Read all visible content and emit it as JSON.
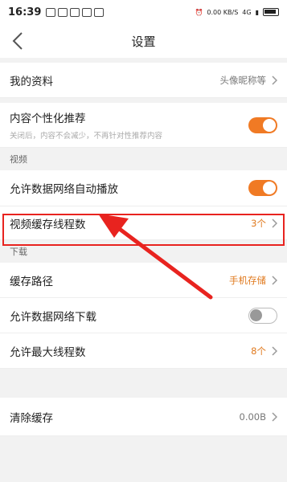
{
  "status_bar": {
    "time": "16:39",
    "net_speed": "0.00 KB/S",
    "network": "4G"
  },
  "header": {
    "title": "设置"
  },
  "rows": {
    "profile": {
      "label": "我的资料",
      "value": "头像昵称等"
    },
    "personalization": {
      "label": "内容个性化推荐",
      "sub": "关闭后，内容不会减少，不再针对性推荐内容",
      "toggle": "on"
    },
    "video_section": "视频",
    "auto_play": {
      "label": "允许数据网络自动播放",
      "toggle": "on"
    },
    "cache_threads": {
      "label": "视频缓存线程数",
      "value": "3个"
    },
    "download_section": "下载",
    "cache_path": {
      "label": "缓存路径",
      "value": "手机存储"
    },
    "mobile_download": {
      "label": "允许数据网络下载",
      "toggle": "off"
    },
    "max_threads": {
      "label": "允许最大线程数",
      "value": "8个"
    },
    "clear_cache": {
      "label": "清除缓存",
      "value": "0.00B"
    }
  },
  "colors": {
    "accent": "#f07a24",
    "annotation": "#e8231f"
  }
}
